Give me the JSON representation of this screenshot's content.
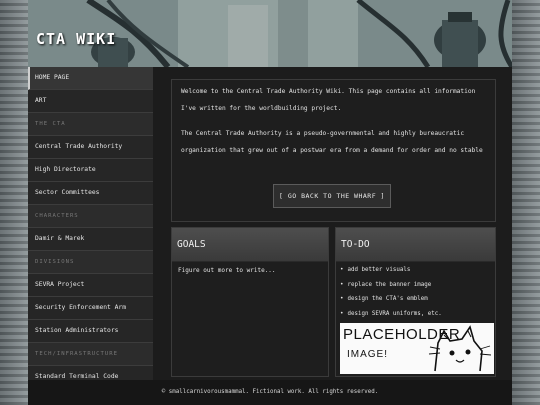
{
  "site": {
    "title": "CTA WIKI"
  },
  "sidebar": {
    "items": [
      {
        "type": "link",
        "label": "HOME PAGE",
        "active": true
      },
      {
        "type": "link",
        "label": "ART"
      },
      {
        "type": "section",
        "label": "THE CTA"
      },
      {
        "type": "link",
        "label": "Central Trade Authority"
      },
      {
        "type": "link",
        "label": "High Directorate"
      },
      {
        "type": "link",
        "label": "Sector Committees"
      },
      {
        "type": "section",
        "label": "CHARACTERS"
      },
      {
        "type": "link",
        "label": "Damir & Marek"
      },
      {
        "type": "section",
        "label": "DIVISIONS"
      },
      {
        "type": "link",
        "label": "SEVRA Project"
      },
      {
        "type": "link",
        "label": "Security Enforcement Arm"
      },
      {
        "type": "link",
        "label": "Station Administrators"
      },
      {
        "type": "section",
        "label": "TECH/INFRASTRUCTURE"
      },
      {
        "type": "link",
        "label": "Standard Terminal Code"
      }
    ]
  },
  "intro": {
    "paragraph1": "Welcome to the Central Trade Authority Wiki. This page contains all information I've written for the worldbuilding project.",
    "paragraph2": "The Central Trade Authority is a pseudo-governmental and highly bureaucratic organization that grew out of a postwar era from a demand for order and no stable",
    "back_button": "[ GO BACK TO THE WHARF ]"
  },
  "goals": {
    "title": "GOALS",
    "text": "Figure out more to write..."
  },
  "todo": {
    "title": "TO-DO",
    "items": [
      "add better visuals",
      "replace the banner image",
      "design the CTA's emblem",
      "design SEVRA uniforms, etc."
    ],
    "image_text_line1": "PLACEHOLDER",
    "image_text_line2": "IMAGE!"
  },
  "footer": {
    "text": "© smallcarnivorousmammal. Fictional work. All rights reserved."
  },
  "colors": {
    "sidebar_bg": "#2a2a2a",
    "main_bg": "#1c1c1c",
    "panel_header": "#444444",
    "text": "#e4e4e4"
  }
}
